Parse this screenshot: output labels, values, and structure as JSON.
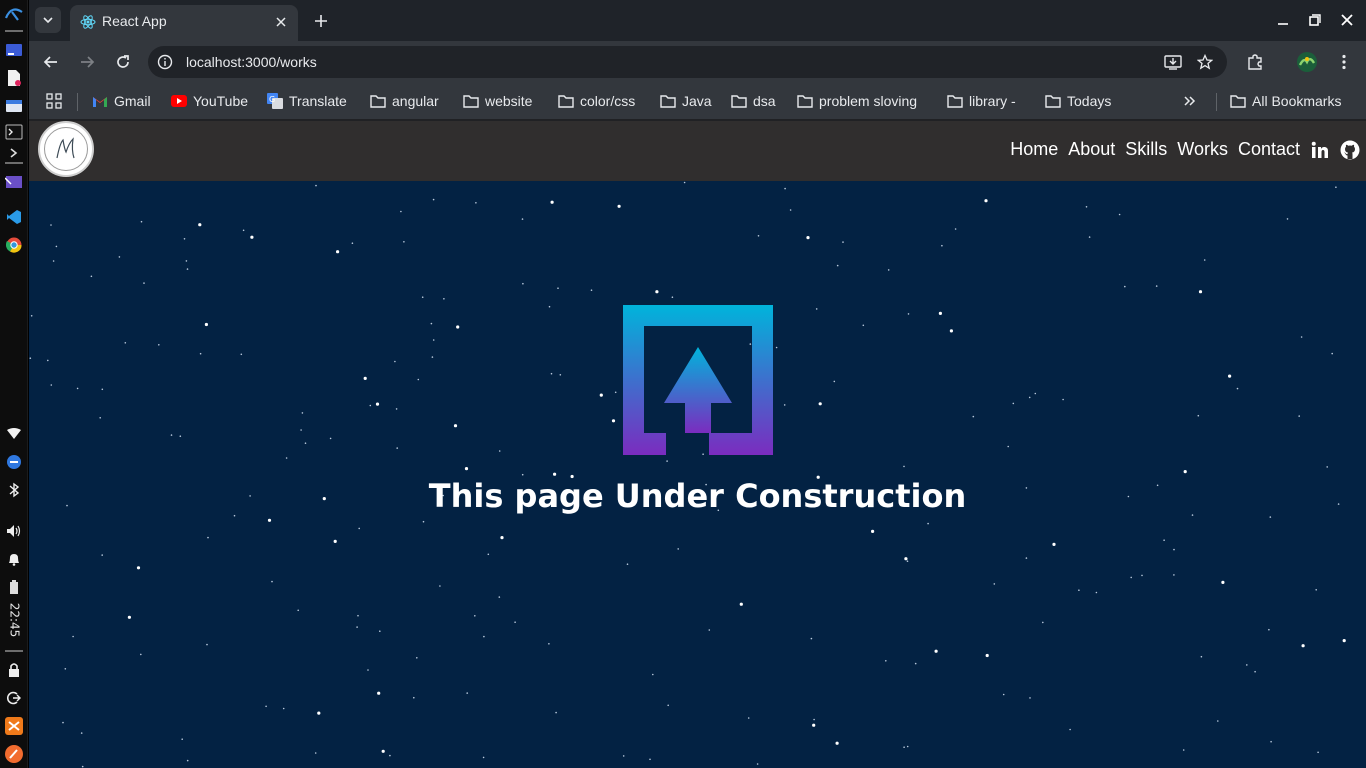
{
  "system_panel": {
    "clock": "22:45"
  },
  "browser": {
    "tab": {
      "title": "React App"
    },
    "address_bar": {
      "url": "localhost:3000/works"
    },
    "bookmarks": [
      {
        "label": "Gmail",
        "icon": "gmail-icon"
      },
      {
        "label": "YouTube",
        "icon": "youtube-icon"
      },
      {
        "label": "Translate",
        "icon": "translate-icon"
      },
      {
        "label": "angular",
        "icon": "folder-icon"
      },
      {
        "label": "website",
        "icon": "folder-icon"
      },
      {
        "label": "color/css",
        "icon": "folder-icon"
      },
      {
        "label": "Java",
        "icon": "folder-icon"
      },
      {
        "label": "dsa",
        "icon": "folder-icon"
      },
      {
        "label": "problem sloving",
        "icon": "folder-icon"
      },
      {
        "label": "library -",
        "icon": "folder-icon"
      },
      {
        "label": "Todays",
        "icon": "folder-icon"
      }
    ],
    "all_bookmarks": "All Bookmarks"
  },
  "page": {
    "nav": {
      "links": [
        "Home",
        "About",
        "Skills",
        "Works",
        "Contact"
      ]
    },
    "under_construction": {
      "message": "This page Under Construction"
    },
    "colors": {
      "background": "#032243",
      "navbar": "#302e2e",
      "gradient_top": "#00b4db",
      "gradient_bottom": "#7b2cbf"
    }
  }
}
